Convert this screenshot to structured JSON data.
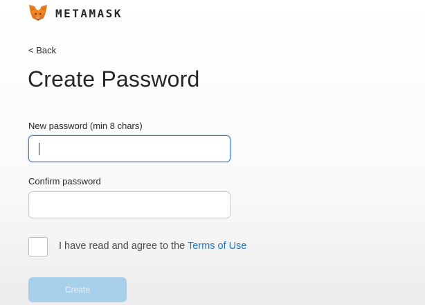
{
  "header": {
    "brand": "METAMASK",
    "logo_icon": "metamask-fox-icon"
  },
  "nav": {
    "back_label": "< Back"
  },
  "page": {
    "title": "Create Password"
  },
  "form": {
    "new_password": {
      "label": "New password (min 8 chars)",
      "value": ""
    },
    "confirm_password": {
      "label": "Confirm password",
      "value": ""
    },
    "agree": {
      "checked": false,
      "text": "I have read and agree to the ",
      "link_text": "Terms of Use"
    },
    "submit": {
      "label": "Create",
      "enabled": false
    }
  },
  "colors": {
    "link": "#1f74c4",
    "button_disabled": "#a9d0ea",
    "focus_border": "#3f7fc8"
  }
}
